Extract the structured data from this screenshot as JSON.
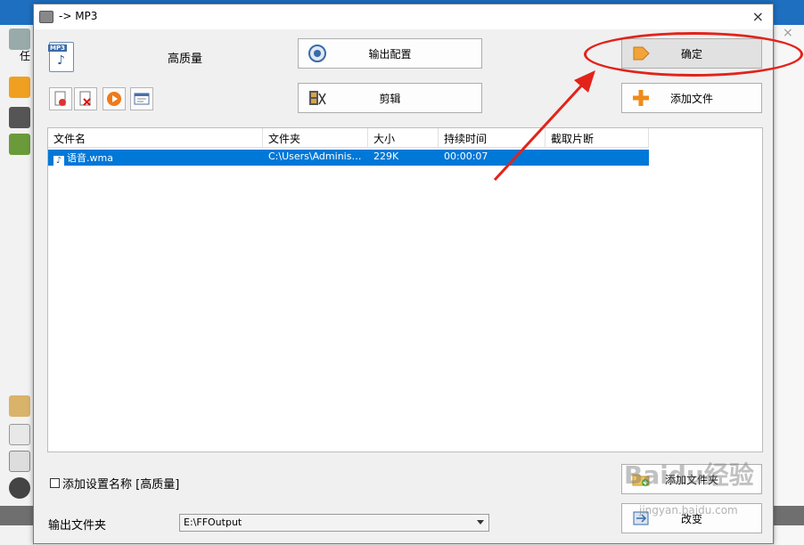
{
  "window": {
    "title": "-> MP3",
    "close_glyph": "×"
  },
  "preset": {
    "icon": "mp3-file-icon",
    "icon_tag": "MP3",
    "quality": "高质量"
  },
  "buttons": {
    "output_config": "输出配置",
    "clip": "剪辑",
    "ok": "确定",
    "add_file": "添加文件",
    "add_folder": "添加文件夹",
    "change": "改变"
  },
  "table": {
    "columns": [
      "文件名",
      "文件夹",
      "大小",
      "持续时间",
      "截取片断"
    ],
    "rows": [
      {
        "name": "语音.wma",
        "folder": "C:\\Users\\Administr...",
        "size": "229K",
        "duration": "00:00:07",
        "clip": ""
      }
    ]
  },
  "options": {
    "add_setting_name": "添加设置名称 [高质量]"
  },
  "output": {
    "label": "输出文件夹",
    "folder": "E:\\FFOutput"
  },
  "watermark": {
    "brand": "Baidu经验",
    "url": "jingyan.baidu.com"
  },
  "background": {
    "partial_label": "任",
    "close_glyph": "×"
  },
  "colors": {
    "selection": "#0078d7",
    "annotation": "#e2231a"
  }
}
